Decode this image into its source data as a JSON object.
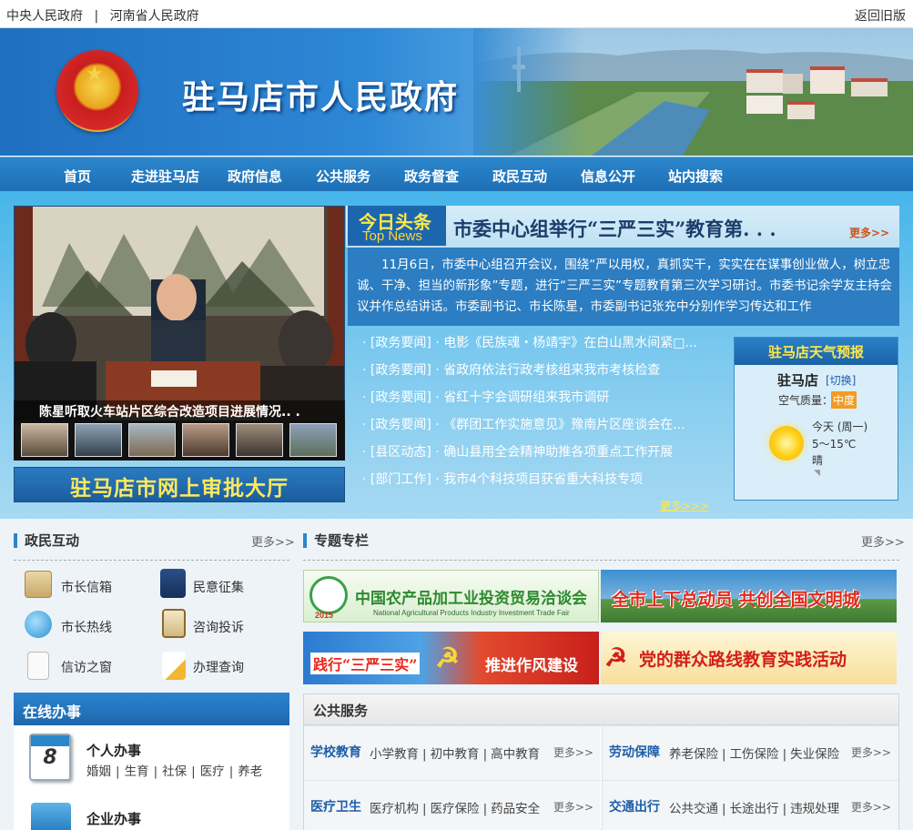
{
  "topbar": {
    "links": [
      "中央人民政府",
      "河南省人民政府"
    ],
    "separator": "|",
    "right_link": "返回旧版"
  },
  "banner": {
    "title": "驻马店市人民政府"
  },
  "nav": {
    "items": [
      "首页",
      "走进驻马店",
      "政府信息",
      "公共服务",
      "政务督查",
      "政民互动",
      "信息公开",
      "站内搜索"
    ]
  },
  "slideshow": {
    "caption": "陈星听取火车站片区综合改造项目进展情况.. .",
    "thumb_count": 6
  },
  "approval_banner": "驻马店市网上审批大厅",
  "headline": {
    "tag_cn": "今日头条",
    "tag_en": "Top News",
    "title": "市委中心组举行“三严三实”教育第. . .",
    "more": "更多>>",
    "summary": "11月6日，市委中心组召开会议，围绕“严以用权，真抓实干，实实在在谋事创业做人，树立忠诚、干净、担当的新形象”专题，进行“三严三实”专题教育第三次学习研讨。市委书记余学友主持会议并作总结讲话。市委副书记、市长陈星，市委副书记张充中分别作学习传达和工作"
  },
  "news": {
    "items": [
      {
        "category": "[政务要闻]",
        "title": "电影《民族魂・杨靖宇》在白山黑水间紧□..."
      },
      {
        "category": "[政务要闻]",
        "title": "省政府依法行政考核组来我市考核检查"
      },
      {
        "category": "[政务要闻]",
        "title": "省红十字会调研组来我市调研"
      },
      {
        "category": "[政务要闻]",
        "title": "《群团工作实施意见》豫南片区座谈会在..."
      },
      {
        "category": "[县区动态]",
        "title": "确山县用全会精神助推各项重点工作开展"
      },
      {
        "category": "[部门工作]",
        "title": "我市4个科技项目获省重大科技专项"
      }
    ],
    "more": "更多>>>"
  },
  "weather": {
    "title": "驻马店天气预报",
    "city": "驻马店",
    "switch": "[切换]",
    "air_label": "空气质量：",
    "air_value": "中度",
    "air_color": "#f39b22",
    "day": "今天 (周一)",
    "temp": "5～15℃",
    "condition": "晴"
  },
  "interaction": {
    "title": "政民互动",
    "more": "更多>>",
    "items": [
      "市长信箱",
      "民意征集",
      "市长热线",
      "咨询投诉",
      "信访之窗",
      "办理查询"
    ]
  },
  "online": {
    "title": "在线办事",
    "personal": {
      "title": "个人办事",
      "links": [
        "婚姻",
        "生育",
        "社保",
        "医疗",
        "养老"
      ]
    },
    "calendar_day": "8",
    "enterprise": {
      "title": "企业办事"
    }
  },
  "special": {
    "title": "专题专栏",
    "more": "更多>>",
    "banners": [
      {
        "text": "中国农产品加工业投资贸易洽谈会",
        "sub": "National Agricultural Products Industry Investment Trade Fair",
        "year": "2015"
      },
      {
        "text": "全市上下总动员  共创全国文明城"
      },
      {
        "left": "践行“三严三实”",
        "right": "推进作风建设"
      },
      {
        "text": "党的群众路线教育实践活动"
      }
    ]
  },
  "public_service": {
    "title": "公共服务",
    "more": "更多>>",
    "cells": [
      {
        "title": "学校教育",
        "links": [
          "小学教育",
          "初中教育",
          "高中教育"
        ]
      },
      {
        "title": "劳动保障",
        "links": [
          "养老保险",
          "工伤保险",
          "失业保险"
        ]
      },
      {
        "title": "医疗卫生",
        "links": [
          "医疗机构",
          "医疗保险",
          "药品安全"
        ]
      },
      {
        "title": "交通出行",
        "links": [
          "公共交通",
          "长途出行",
          "违规处理"
        ]
      }
    ]
  }
}
